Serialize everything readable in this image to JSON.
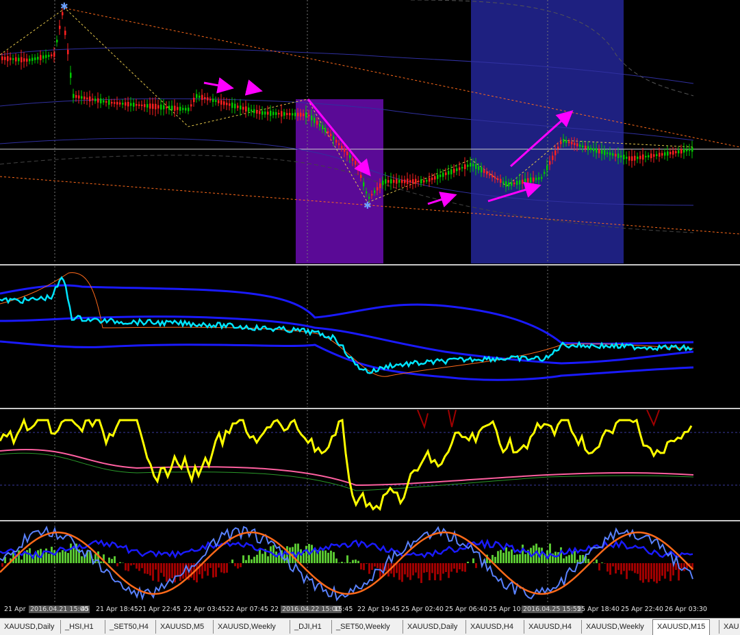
{
  "chart": {
    "symbol": "XAUUSD",
    "timeframe": "M15",
    "colors": {
      "background": "#000000",
      "bull_candle": "#00c800",
      "bear_candle": "#ff2020",
      "zigzag": "#e6c84a",
      "trendline": "#ff6a1a",
      "arrows": "#ff00ff",
      "highlight_purple": "#5a0a96",
      "highlight_blue": "#1e2080",
      "signal_line": "#00e5ff",
      "band_line": "#1a1aff",
      "wpr_line": "#ffff00",
      "macd_up": "#5ac832",
      "macd_down": "#a00000",
      "fast_line": "#5a82ff",
      "slow_line": "#ff6a1a"
    }
  },
  "time_axis": [
    {
      "label": "21 Apr",
      "highlight": false
    },
    {
      "label": "2016.04.21 15:00",
      "highlight": true
    },
    {
      "label": "45",
      "highlight": false
    },
    {
      "label": "21 Apr 18:45",
      "highlight": false
    },
    {
      "label": "21 Apr 22:45",
      "highlight": false
    },
    {
      "label": "22 Apr 03:45",
      "highlight": false
    },
    {
      "label": "22 Apr 07:45",
      "highlight": false
    },
    {
      "label": "22",
      "highlight": false
    },
    {
      "label": "2016.04.22 15:00",
      "highlight": true
    },
    {
      "label": "15:45",
      "highlight": false
    },
    {
      "label": "22 Apr 19:45",
      "highlight": false
    },
    {
      "label": "25 Apr 02:40",
      "highlight": false
    },
    {
      "label": "25 Apr 06:40",
      "highlight": false
    },
    {
      "label": "25 Apr 10:",
      "highlight": false
    },
    {
      "label": "2016.04.25 15:55",
      "highlight": true
    },
    {
      "label": "25 Apr 18:40",
      "highlight": false
    },
    {
      "label": "25 Apr 22:40",
      "highlight": false
    },
    {
      "label": "26 Apr 03:30",
      "highlight": false
    }
  ],
  "tabs": [
    {
      "label": "XAUUSD,Daily",
      "active": false
    },
    {
      "label": "_HSI,H1",
      "active": false
    },
    {
      "label": "_SET50,H4",
      "active": false
    },
    {
      "label": "XAUUSD,M5",
      "active": false
    },
    {
      "label": "XAUUSD,Weekly",
      "active": false
    },
    {
      "label": "_DJI,H1",
      "active": false
    },
    {
      "label": "_SET50,Weekly",
      "active": false
    },
    {
      "label": "XAUUSD,Daily",
      "active": false
    },
    {
      "label": "XAUUSD,H4",
      "active": false
    },
    {
      "label": "XAUUSD,H4",
      "active": false
    },
    {
      "label": "XAUUSD,Weekly",
      "active": false
    },
    {
      "label": "XAUUSD,M15",
      "active": true
    },
    {
      "label": "XAU",
      "active": false
    }
  ]
}
